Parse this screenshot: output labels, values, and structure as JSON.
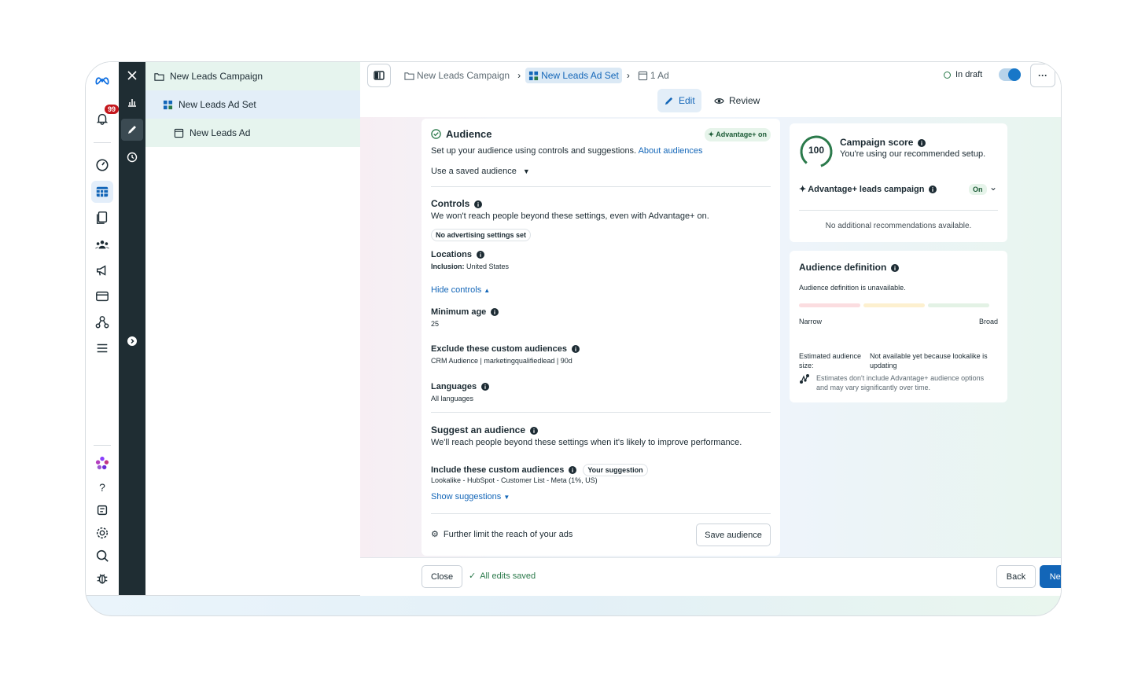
{
  "rail": {
    "notification_count": "99"
  },
  "tree": {
    "campaign": "New Leads Campaign",
    "adset": "New Leads Ad Set",
    "ad": "New Leads Ad"
  },
  "breadcrumb": {
    "campaign": "New Leads Campaign",
    "adset": "New Leads Ad Set",
    "ad": "1 Ad"
  },
  "status": {
    "label": "In draft",
    "more": "···"
  },
  "modes": {
    "edit": "Edit",
    "review": "Review"
  },
  "audience": {
    "title": "Audience",
    "advantage_badge": "Advantage+ on",
    "description": "Set up your audience using controls and suggestions.",
    "about_link": "About audiences",
    "saved_audience": "Use a saved audience",
    "controls_title": "Controls",
    "controls_desc": "We won't reach people beyond these settings, even with Advantage+ on.",
    "no_settings_pill": "No advertising settings set",
    "locations_title": "Locations",
    "locations_inclusion_label": "Inclusion:",
    "locations_inclusion_value": "United States",
    "hide_controls": "Hide controls",
    "min_age_title": "Minimum age",
    "min_age_value": "25",
    "exclude_title": "Exclude these custom audiences",
    "exclude_value": "CRM Audience | marketingqualifiedlead | 90d",
    "languages_title": "Languages",
    "languages_value": "All languages",
    "suggest_title": "Suggest an audience",
    "suggest_desc": "We'll reach people beyond these settings when it's likely to improve performance.",
    "include_title": "Include these custom audiences",
    "your_suggestion": "Your suggestion",
    "include_value": "Lookalike - HubSpot - Customer List - Meta (1%, US)",
    "show_suggestions": "Show suggestions",
    "further_limit": "Further limit the reach of your ads",
    "save_audience": "Save audience"
  },
  "score": {
    "value": "100",
    "title": "Campaign score",
    "subtitle": "You're using our recommended setup.",
    "advantage_label": "Advantage+ leads campaign",
    "on_pill": "On",
    "no_recs": "No additional recommendations available."
  },
  "definition": {
    "title": "Audience definition",
    "unavailable": "Audience definition is unavailable.",
    "narrow": "Narrow",
    "broad": "Broad",
    "estimated_label": "Estimated audience size:",
    "estimated_value": "Not available yet because lookalike is updating",
    "note": "Estimates don't include Advantage+ audience options and may vary significantly over time."
  },
  "footer": {
    "close": "Close",
    "saved": "All edits saved",
    "back": "Back",
    "next": "Next"
  },
  "colors": {
    "accent": "#1366b8",
    "success": "#2b7a4b",
    "badge": "#c4161c"
  }
}
